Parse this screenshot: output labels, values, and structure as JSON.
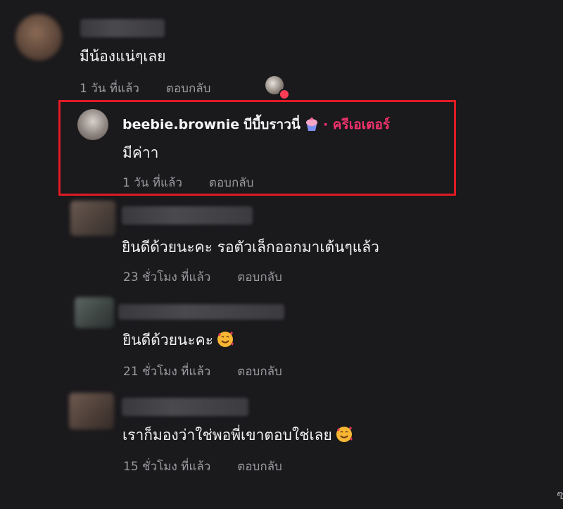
{
  "comments": [
    {
      "text": "มีน้องแน่ๆเลย",
      "time": "1 วัน ที่แล้ว",
      "reply_label": "ตอบกลับ"
    },
    {
      "username": "beebie.brownie",
      "display_name": "บีบี้บราวนี่",
      "creator_badge": "· ครีเอเตอร์",
      "text": "มีค่าา",
      "time": "1 วัน ที่แล้ว",
      "reply_label": "ตอบกลับ"
    },
    {
      "text": "ยินดีด้วยนะคะ รอตัวเล็กออกมาเต้นๆแล้ว",
      "time": "23 ชั่วโมง ที่แล้ว",
      "reply_label": "ตอบกลับ"
    },
    {
      "text": "ยินดีด้วยนะคะ",
      "emoji": "smiling-face-with-hearts",
      "time": "21 ชั่วโมง ที่แล้ว",
      "reply_label": "ตอบกลับ"
    },
    {
      "text": "เราก็มองว่าใช่พอพี่เขาตอบใช่เลย",
      "emoji": "smiling-face-with-hearts",
      "time": "15 ชั่วโมง ที่แล้ว",
      "reply_label": "ตอบกลับ"
    }
  ],
  "corner_text": "ซ่",
  "colors": {
    "background": "#1a191c",
    "creator_accent": "#f0336b",
    "highlight_border": "#e01b24",
    "meta_text": "#9b9b9f"
  }
}
